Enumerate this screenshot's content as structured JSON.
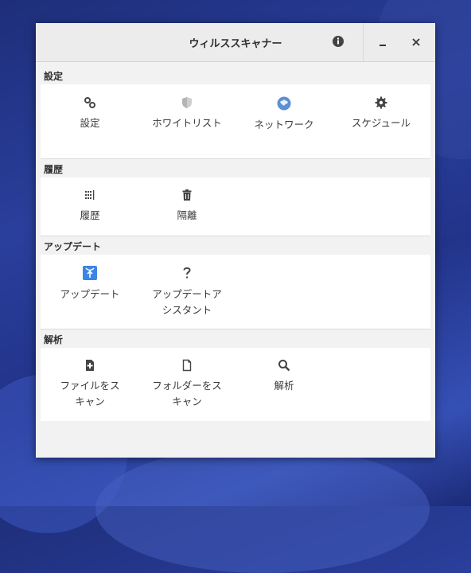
{
  "window": {
    "title": "ウィルススキャナー"
  },
  "sections": [
    {
      "label": "設定",
      "items": [
        {
          "label": "設定",
          "icon": "gears-icon"
        },
        {
          "label": "ホワイトリスト",
          "icon": "shield-icon"
        },
        {
          "label": "ネットワーク",
          "icon": "globe-icon"
        },
        {
          "label": "スケジュール",
          "icon": "gear-icon"
        }
      ]
    },
    {
      "label": "履歴",
      "items": [
        {
          "label": "履歴",
          "icon": "history-icon"
        },
        {
          "label": "隔離",
          "icon": "trash-icon"
        }
      ]
    },
    {
      "label": "アップデート",
      "items": [
        {
          "label": "アップデート",
          "icon": "update-icon"
        },
        {
          "label": "アップデートア\nシスタント",
          "icon": "question-icon"
        }
      ]
    },
    {
      "label": "解析",
      "items": [
        {
          "label": "ファイルをス\nキャン",
          "icon": "file-add-icon"
        },
        {
          "label": "フォルダーをス\nキャン",
          "icon": "file-icon"
        },
        {
          "label": "解析",
          "icon": "search-icon"
        }
      ]
    }
  ],
  "colors": {
    "accent": "#3b86e3",
    "globe": "#5b8fd6"
  }
}
